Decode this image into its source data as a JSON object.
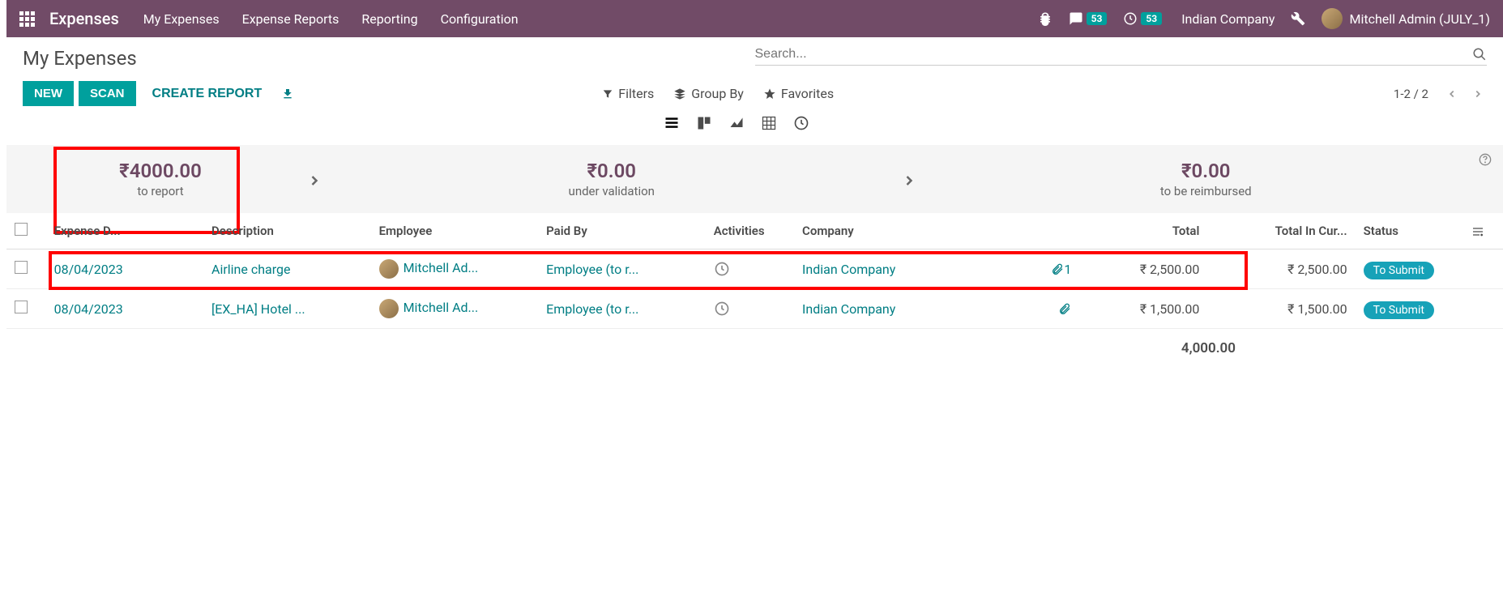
{
  "nav": {
    "brand": "Expenses",
    "items": [
      "My Expenses",
      "Expense Reports",
      "Reporting",
      "Configuration"
    ],
    "messages_badge": "53",
    "activities_badge": "53",
    "company": "Indian Company",
    "user": "Mitchell Admin (JULY_1)"
  },
  "page": {
    "title": "My Expenses",
    "search_placeholder": "Search...",
    "new_btn": "NEW",
    "scan_btn": "SCAN",
    "create_report_btn": "CREATE REPORT",
    "filters_label": "Filters",
    "groupby_label": "Group By",
    "favorites_label": "Favorites",
    "pager": "1-2 / 2"
  },
  "summary": {
    "to_report_amount": "₹4000.00",
    "to_report_label": "to report",
    "under_validation_amount": "₹0.00",
    "under_validation_label": "under validation",
    "to_reimburse_amount": "₹0.00",
    "to_reimburse_label": "to be reimbursed"
  },
  "table": {
    "headers": {
      "date": "Expense D...",
      "description": "Description",
      "employee": "Employee",
      "paid_by": "Paid By",
      "activities": "Activities",
      "company": "Company",
      "total": "Total",
      "total_currency": "Total In Cur...",
      "status": "Status"
    },
    "rows": [
      {
        "date": "08/04/2023",
        "description": "Airline charge",
        "employee": "Mitchell Ad...",
        "paid_by": "Employee (to r...",
        "company": "Indian Company",
        "attachment_count": "1",
        "total": "₹ 2,500.00",
        "total_currency": "₹ 2,500.00",
        "status": "To Submit"
      },
      {
        "date": "08/04/2023",
        "description": "[EX_HA] Hotel ...",
        "employee": "Mitchell Ad...",
        "paid_by": "Employee (to r...",
        "company": "Indian Company",
        "attachment_count": "",
        "total": "₹ 1,500.00",
        "total_currency": "₹ 1,500.00",
        "status": "To Submit"
      }
    ],
    "footer_total": "4,000.00"
  }
}
